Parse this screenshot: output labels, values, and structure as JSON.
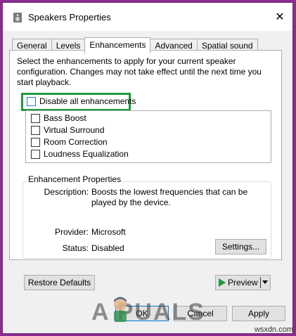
{
  "window": {
    "title": "Speakers Properties",
    "close_glyph": "✕"
  },
  "tabs": [
    {
      "label": "General"
    },
    {
      "label": "Levels"
    },
    {
      "label": "Enhancements"
    },
    {
      "label": "Advanced"
    },
    {
      "label": "Spatial sound"
    }
  ],
  "active_tab": "Enhancements",
  "intro_text": "Select the enhancements to apply for your current speaker configuration. Changes may not take effect until the next time you start playback.",
  "disable_all": {
    "label": "Disable all enhancements",
    "checked": false
  },
  "enhancements": [
    {
      "label": "Bass Boost",
      "checked": false
    },
    {
      "label": "Virtual Surround",
      "checked": false
    },
    {
      "label": "Room Correction",
      "checked": false
    },
    {
      "label": "Loudness Equalization",
      "checked": false
    }
  ],
  "properties": {
    "legend": "Enhancement Properties",
    "description_label": "Description:",
    "description_value": "Boosts the lowest frequencies that can be played by the device.",
    "provider_label": "Provider:",
    "provider_value": "Microsoft",
    "status_label": "Status:",
    "status_value": "Disabled",
    "settings_button": "Settings..."
  },
  "buttons": {
    "restore_defaults": "Restore Defaults",
    "preview": "Preview",
    "ok": "OK",
    "cancel": "Cancel",
    "apply": "Apply"
  },
  "watermark": {
    "text": "A   PUALS",
    "site": "wsxdn.com"
  },
  "colors": {
    "highlight_border": "#1d9a3c",
    "background": "#8a2d8e",
    "play_icon": "#1d9a3c"
  }
}
